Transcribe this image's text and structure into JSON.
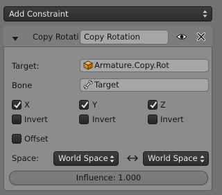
{
  "add_constraint": {
    "label": "Add Constraint",
    "icon": "updown-arrows-icon"
  },
  "constraint": {
    "name_label": "Copy Rotati",
    "name_value": "Copy Rotation",
    "icons": {
      "collapse": "triangle-down-icon",
      "visibility": "eye-icon",
      "close": "x-icon"
    }
  },
  "target": {
    "label": "Target:",
    "value": "Armature.Copy.Rot",
    "icon": "armature-cube-icon"
  },
  "bone": {
    "label": "Bone",
    "value": "Target",
    "icon": "bone-icon"
  },
  "axes": [
    {
      "label": "X",
      "checked": true
    },
    {
      "label": "Y",
      "checked": true
    },
    {
      "label": "Z",
      "checked": true
    }
  ],
  "invert": [
    {
      "label": "Invert",
      "checked": false
    },
    {
      "label": "Invert",
      "checked": false
    },
    {
      "label": "Invert",
      "checked": false
    }
  ],
  "offset": {
    "label": "Offset",
    "checked": false
  },
  "space": {
    "label": "Space:",
    "owner": "World Space",
    "target": "World Space",
    "swap_icon": "double-arrow-icon"
  },
  "influence": {
    "text": "Influence: 1.000",
    "value": 1.0
  },
  "colors": {
    "panel_bg": "#8c8c8c",
    "field_bg": "#a6a6a6",
    "dark_button": "#2e2e2e",
    "check_mark": "#e6e6e6"
  }
}
